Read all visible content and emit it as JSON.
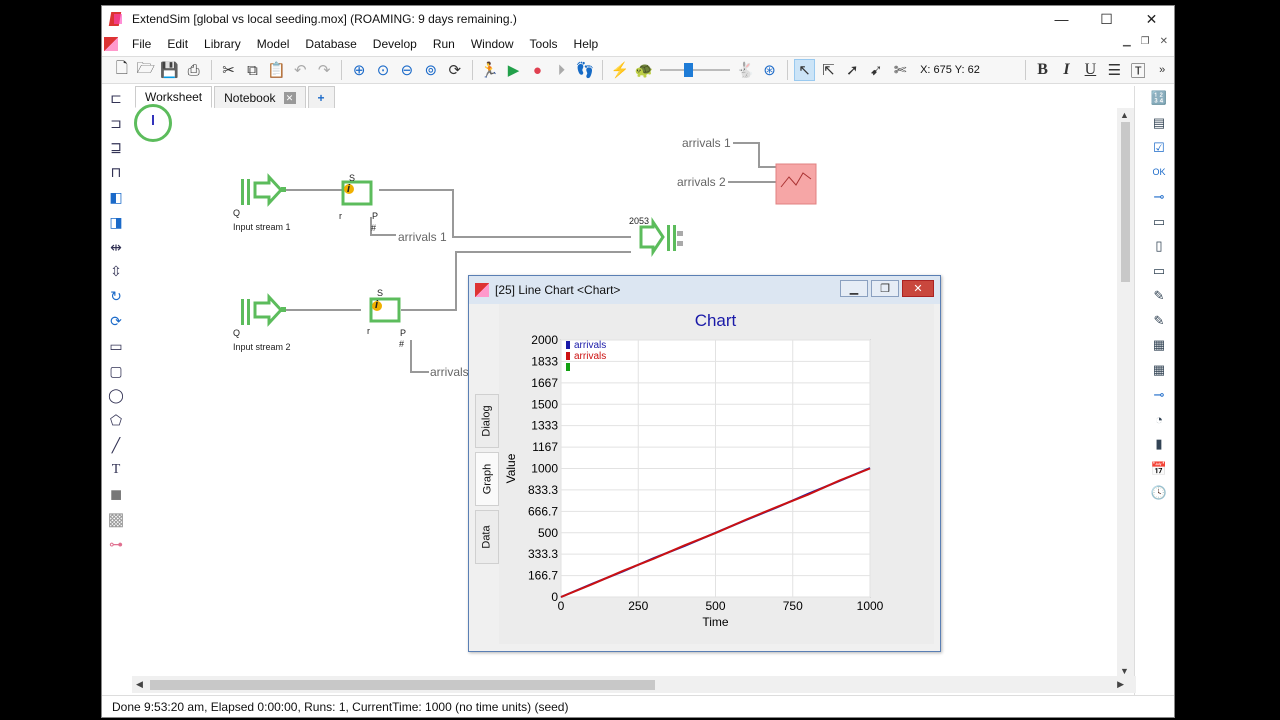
{
  "window": {
    "title": "ExtendSim  [global vs local seeding.mox]   (ROAMING: 9 days remaining.)",
    "controls": [
      "—",
      "☐",
      "✕"
    ]
  },
  "menu": [
    "File",
    "Edit",
    "Library",
    "Model",
    "Database",
    "Develop",
    "Run",
    "Window",
    "Tools",
    "Help"
  ],
  "toolbar": {
    "coord_readout": "X: 675 Y: 62",
    "bold": "B",
    "italic": "I",
    "underline": "U"
  },
  "tabs": {
    "worksheet": "Worksheet",
    "notebook": "Notebook",
    "add": "+"
  },
  "canvas": {
    "input1_label": "Input stream 1",
    "input2_label": "Input stream 2",
    "arrivals1": "arrivals 1",
    "arrivals2": "arrivals 2",
    "arrivals_lbl": "arrivals 1",
    "arrivals_lbl2": "arrivals",
    "exit_count": "2053",
    "q": "Q",
    "s": "S",
    "p": "P",
    "r": "r",
    "hash": "#",
    "i": "i"
  },
  "chart_window": {
    "title": "[25] Line Chart <Chart>",
    "vtabs": [
      "Dialog",
      "Graph",
      "Data"
    ]
  },
  "chart_data": {
    "type": "line",
    "title": "Chart",
    "xlabel": "Time",
    "ylabel": "Value",
    "xlim": [
      0,
      1000
    ],
    "ylim": [
      0,
      2000
    ],
    "x_ticks": [
      "0",
      "250",
      "500",
      "750",
      "1000"
    ],
    "y_ticks": [
      "0",
      "166.7",
      "333.3",
      "500",
      "666.7",
      "833.3",
      "1000",
      "1167",
      "1333",
      "1500",
      "1667",
      "1833",
      "2000"
    ],
    "series": [
      {
        "name": "arrivals",
        "color": "#1a1aa8",
        "x": [
          0,
          100,
          200,
          300,
          400,
          500,
          600,
          700,
          800,
          900,
          1000
        ],
        "y": [
          0,
          102,
          199,
          302,
          398,
          500,
          601,
          699,
          803,
          902,
          1003
        ]
      },
      {
        "name": "arrivals",
        "color": "#cc1111",
        "x": [
          0,
          100,
          200,
          300,
          400,
          500,
          600,
          700,
          800,
          900,
          1000
        ],
        "y": [
          0,
          99,
          203,
          298,
          402,
          497,
          603,
          702,
          797,
          905,
          1000
        ]
      },
      {
        "name": "",
        "color": "#11a011",
        "x": [],
        "y": []
      }
    ],
    "grid": true,
    "legend_position": "top-left"
  },
  "status": "Done 9:53:20 am, Elapsed 0:00:00, Runs: 1, CurrentTime: 1000 (no time units) (seed)"
}
